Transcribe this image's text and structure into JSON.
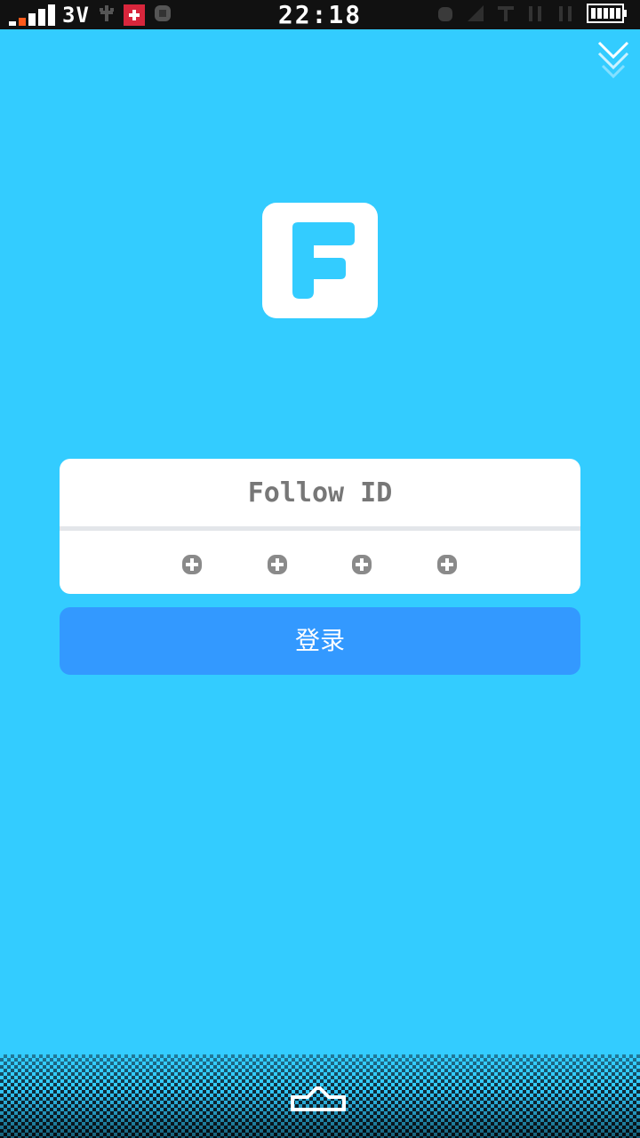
{
  "status_bar": {
    "network_type": "3V",
    "time": "22:18",
    "icons": [
      "signal-icon",
      "usb-icon",
      "swiss-flag-icon",
      "sync-icon",
      "alarm-icon",
      "vibrate-icon",
      "battery-icon"
    ]
  },
  "login": {
    "id_placeholder": "Follow ID",
    "pin_placeholder_count": 4,
    "login_label": "登录"
  },
  "colors": {
    "background": "#33ccff",
    "button": "#3399ff",
    "card": "#ffffff",
    "status_bar": "#111111"
  }
}
